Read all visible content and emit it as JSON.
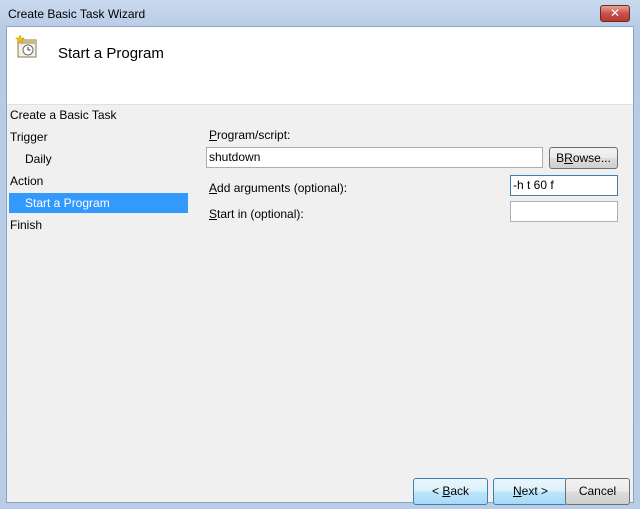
{
  "window": {
    "title": "Create Basic Task Wizard",
    "close_glyph": "✕"
  },
  "header": {
    "icon": "task-scheduler-icon",
    "title": "Start a Program"
  },
  "steps": [
    {
      "label": "Create a Basic Task",
      "level": 0,
      "active": false
    },
    {
      "label": "Trigger",
      "level": 0,
      "active": false
    },
    {
      "label": "Daily",
      "level": 1,
      "active": false
    },
    {
      "label": "Action",
      "level": 0,
      "active": false
    },
    {
      "label": "Start a Program",
      "level": 1,
      "active": true
    },
    {
      "label": "Finish",
      "level": 0,
      "active": false
    }
  ],
  "form": {
    "program_label": "Program/script:",
    "program_label_hotkey": "P",
    "program_label_rest": "rogram/script:",
    "program_value": "shutdown",
    "browse_hotkey": "R",
    "browse_label": "Browse...",
    "browse_pre": "B",
    "browse_rest": "owse...",
    "args_label_hotkey": "A",
    "args_label_rest": "dd arguments (optional):",
    "args_value": "-h t 60 f",
    "startin_label_hotkey": "S",
    "startin_label_rest": "tart in (optional):",
    "startin_value": ""
  },
  "buttons": {
    "back_pre": "< ",
    "back_hotkey": "B",
    "back_rest": "ack",
    "next_hotkey": "N",
    "next_rest": "ext >",
    "cancel_label": "Cancel"
  }
}
